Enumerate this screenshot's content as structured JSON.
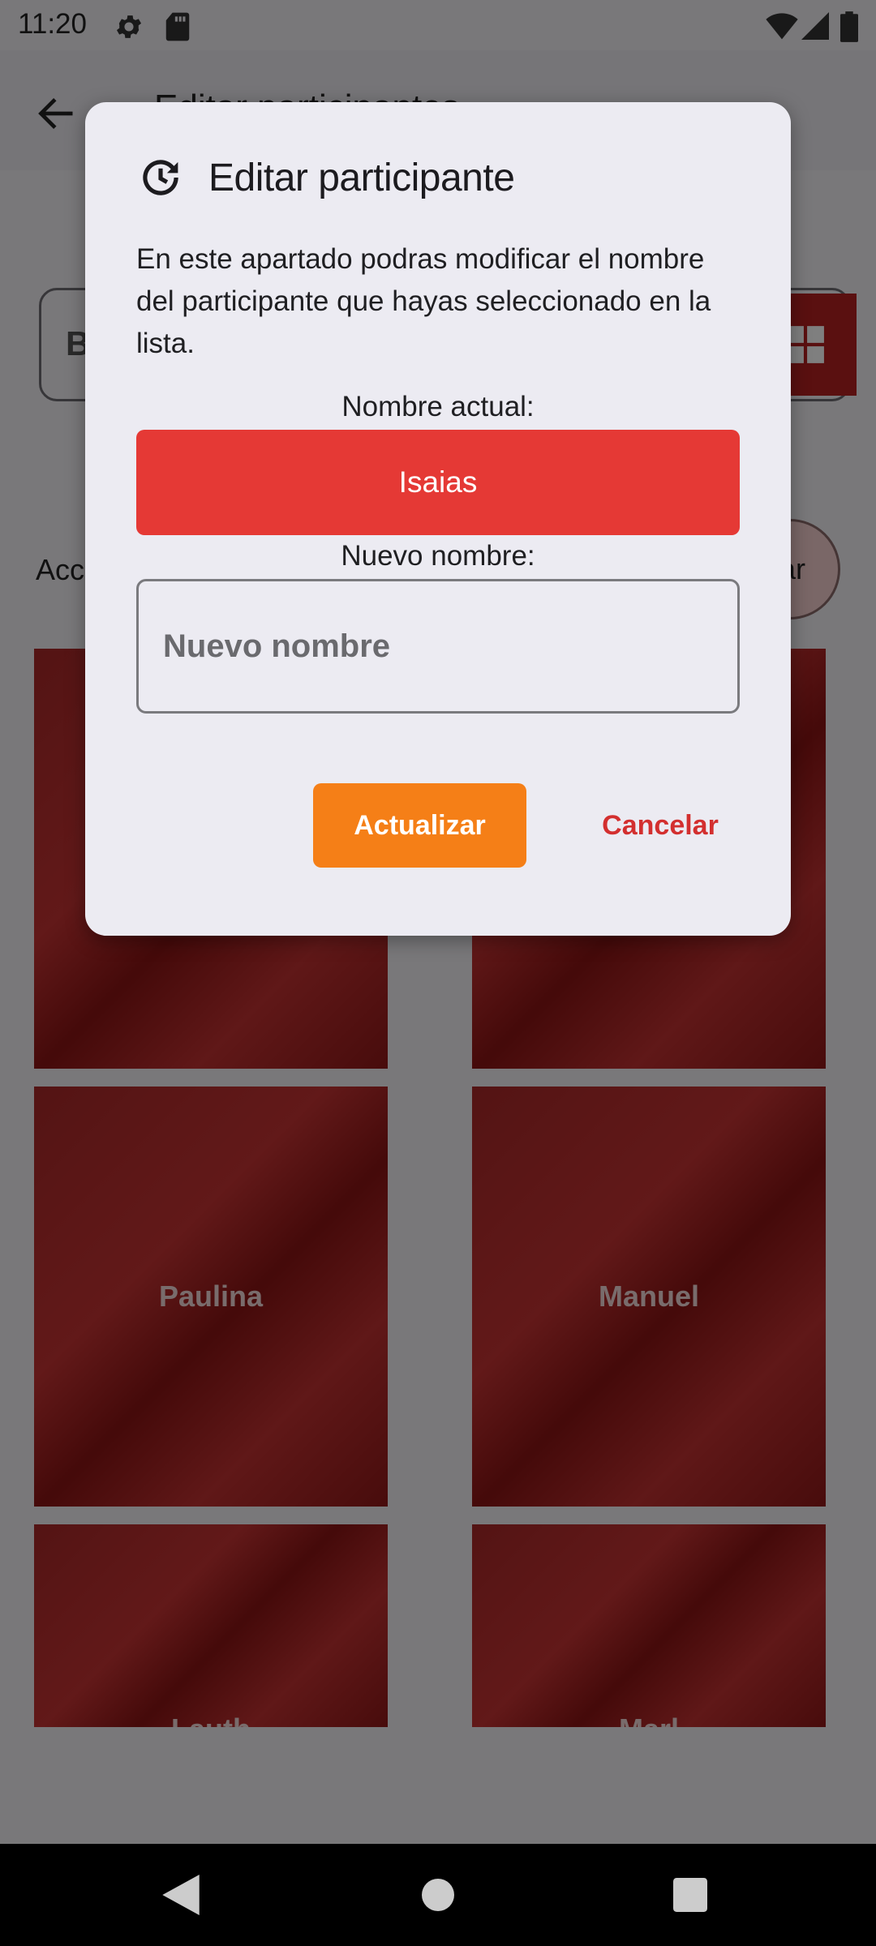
{
  "status_bar": {
    "time": "11:20",
    "icons": [
      "settings-icon",
      "sd-card-icon",
      "wifi-icon",
      "cellular-signal-icon",
      "battery-icon"
    ]
  },
  "app_bar": {
    "title": "Editar participantes",
    "back_icon": "arrow-back-icon"
  },
  "background": {
    "search_placeholder": "B",
    "section_label": "Acc",
    "pill_button_label": "ar",
    "tiles": [
      "",
      "",
      "Paulina",
      "Manuel",
      "Lauth",
      "Marl"
    ]
  },
  "dialog": {
    "icon": "history-icon",
    "title": "Editar participante",
    "description": "En este apartado podras modificar el nombre del participante que hayas seleccionado en la lista.",
    "current_name_label": "Nombre actual:",
    "current_name": "Isaias",
    "new_name_label": "Nuevo nombre:",
    "new_name_placeholder": "Nuevo nombre",
    "new_name_value": "",
    "update_button": "Actualizar",
    "cancel_button": "Cancelar"
  },
  "colors": {
    "accent_red": "#e53935",
    "update_orange": "#f57f17",
    "cancel_red": "#d32f2f",
    "tile_red": "#b52020"
  }
}
